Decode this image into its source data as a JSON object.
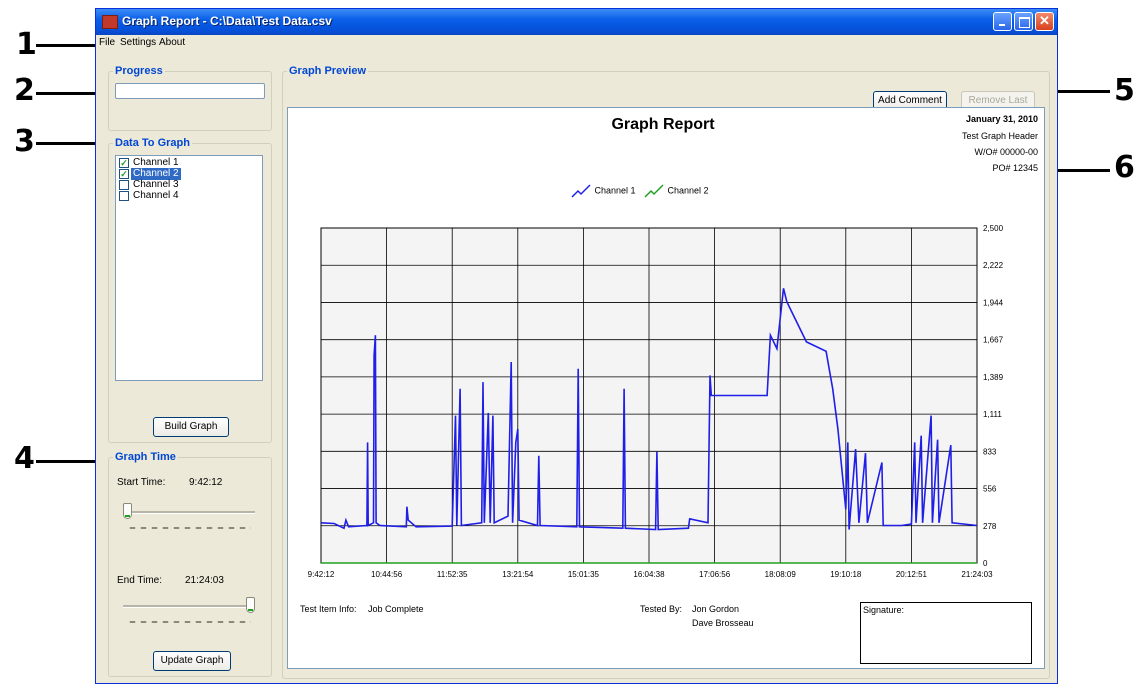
{
  "callouts": [
    "1",
    "2",
    "3",
    "4",
    "5",
    "6"
  ],
  "window": {
    "title": "Graph Report - C:\\Data\\Test Data.csv",
    "close_glyph": "✕",
    "icons": [
      "app-icon",
      "minimize-icon",
      "maximize-icon",
      "close-icon"
    ]
  },
  "menu": {
    "file": "File",
    "settings": "Settings",
    "about": "About"
  },
  "progress": {
    "legend": "Progress",
    "value": 0
  },
  "data_to_graph": {
    "legend": "Data To Graph",
    "channels": [
      {
        "label": "Channel 1",
        "checked": true,
        "selected": false
      },
      {
        "label": "Channel 2",
        "checked": true,
        "selected": true
      },
      {
        "label": "Channel 3",
        "checked": false,
        "selected": false
      },
      {
        "label": "Channel 4",
        "checked": false,
        "selected": false
      }
    ],
    "check_glyph": "✓",
    "build_button": "Build Graph"
  },
  "graph_time": {
    "legend": "Graph Time",
    "start_label": "Start Time:",
    "start_value": "9:42:12",
    "start_slider_fraction": 0,
    "end_label": "End Time:",
    "end_value": "21:24:03",
    "end_slider_fraction": 1,
    "update_button": "Update Graph"
  },
  "graph_preview": {
    "legend": "Graph Preview",
    "add_comment_button": "Add Comment",
    "remove_last_button": "Remove Last"
  },
  "report": {
    "title": "Graph Report",
    "date": "January 31, 2010",
    "header": "Test Graph Header",
    "wo": "W/O# 00000-00",
    "po": "PO# 12345",
    "legend": [
      {
        "name": "Channel 1",
        "color": "#1f1fe8"
      },
      {
        "name": "Channel 2",
        "color": "#21a121"
      }
    ],
    "test_item_info_label": "Test Item Info:",
    "test_item_info_value": "Job Complete",
    "tested_by_label": "Tested By:",
    "tested_by": [
      "Jon Gordon",
      "Dave Brosseau"
    ],
    "signature_label": "Signature:"
  },
  "chart_data": {
    "type": "line",
    "x_tick_labels": [
      "9:42:12",
      "10:44:56",
      "11:52:35",
      "13:21:54",
      "15:01:35",
      "16:04:38",
      "17:06:56",
      "18:08:09",
      "19:10:18",
      "20:12:51",
      "21:24:03"
    ],
    "y_tick_labels": [
      "0",
      "278",
      "556",
      "833",
      "1,111",
      "1,389",
      "1,667",
      "1,944",
      "2,222",
      "2,500"
    ],
    "ylim": [
      0,
      2500
    ],
    "grid": true,
    "legend_position": "top-center",
    "series": [
      {
        "name": "Channel 1",
        "color": "#1f1fe8",
        "points": [
          [
            0,
            300
          ],
          [
            0.2,
            295
          ],
          [
            0.35,
            260
          ],
          [
            0.38,
            320
          ],
          [
            0.42,
            270
          ],
          [
            0.7,
            280
          ],
          [
            0.71,
            900
          ],
          [
            0.72,
            280
          ],
          [
            0.8,
            300
          ],
          [
            0.81,
            1550
          ],
          [
            0.83,
            1700
          ],
          [
            0.84,
            300
          ],
          [
            0.9,
            280
          ],
          [
            1.3,
            270
          ],
          [
            1.31,
            420
          ],
          [
            1.33,
            320
          ],
          [
            1.45,
            270
          ],
          [
            2.0,
            275
          ],
          [
            2.05,
            1100
          ],
          [
            2.07,
            280
          ],
          [
            2.12,
            1300
          ],
          [
            2.14,
            280
          ],
          [
            2.45,
            300
          ],
          [
            2.47,
            1350
          ],
          [
            2.49,
            300
          ],
          [
            2.55,
            1120
          ],
          [
            2.58,
            300
          ],
          [
            2.62,
            1100
          ],
          [
            2.64,
            300
          ],
          [
            2.85,
            350
          ],
          [
            2.9,
            1500
          ],
          [
            2.92,
            300
          ],
          [
            2.97,
            900
          ],
          [
            3.0,
            1000
          ],
          [
            3.02,
            320
          ],
          [
            3.3,
            280
          ],
          [
            3.32,
            800
          ],
          [
            3.34,
            280
          ],
          [
            3.9,
            270
          ],
          [
            3.92,
            1450
          ],
          [
            3.94,
            270
          ],
          [
            4.6,
            260
          ],
          [
            4.62,
            1300
          ],
          [
            4.64,
            260
          ],
          [
            5.1,
            250
          ],
          [
            5.12,
            830
          ],
          [
            5.14,
            250
          ],
          [
            5.6,
            260
          ],
          [
            5.62,
            330
          ],
          [
            5.9,
            300
          ],
          [
            5.93,
            1400
          ],
          [
            5.95,
            1250
          ],
          [
            6.8,
            1250
          ],
          [
            6.85,
            1700
          ],
          [
            6.95,
            1600
          ],
          [
            7.05,
            2050
          ],
          [
            7.1,
            1950
          ],
          [
            7.4,
            1650
          ],
          [
            7.7,
            1580
          ],
          [
            7.8,
            1300
          ],
          [
            7.88,
            1000
          ],
          [
            8.0,
            400
          ],
          [
            8.03,
            900
          ],
          [
            8.05,
            250
          ],
          [
            8.15,
            850
          ],
          [
            8.2,
            300
          ],
          [
            8.3,
            820
          ],
          [
            8.33,
            300
          ],
          [
            8.55,
            750
          ],
          [
            8.57,
            280
          ],
          [
            8.85,
            280
          ],
          [
            9.0,
            290
          ],
          [
            9.05,
            900
          ],
          [
            9.07,
            300
          ],
          [
            9.15,
            950
          ],
          [
            9.17,
            300
          ],
          [
            9.3,
            1100
          ],
          [
            9.32,
            300
          ],
          [
            9.4,
            920
          ],
          [
            9.42,
            300
          ],
          [
            9.6,
            880
          ],
          [
            9.62,
            300
          ],
          [
            10,
            280
          ]
        ]
      },
      {
        "name": "Channel 2",
        "color": "#21a121",
        "points": [
          [
            0,
            0
          ],
          [
            10,
            0
          ]
        ]
      }
    ]
  }
}
